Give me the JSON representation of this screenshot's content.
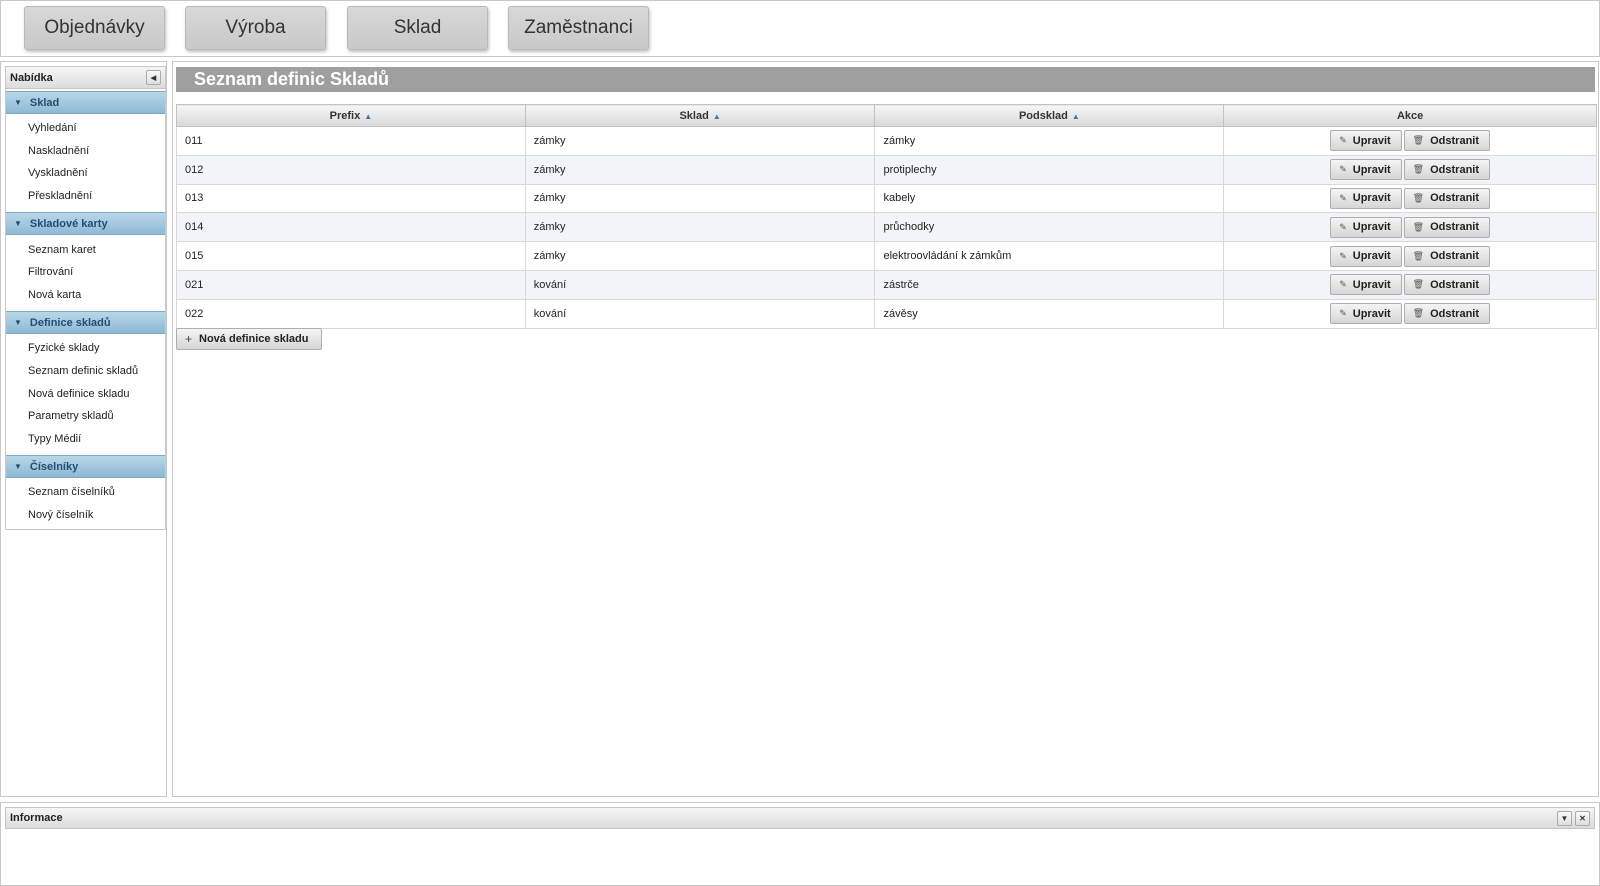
{
  "nav": {
    "tabs": [
      {
        "label": "Objednávky"
      },
      {
        "label": "Výroba"
      },
      {
        "label": "Sklad"
      },
      {
        "label": "Zaměstnanci"
      }
    ]
  },
  "sidebar": {
    "title": "Nabídka",
    "sections": [
      {
        "title": "Sklad",
        "items": [
          "Vyhledání",
          "Naskladnění",
          "Vyskladnění",
          "Přeskladnění"
        ]
      },
      {
        "title": "Skladové karty",
        "items": [
          "Seznam karet",
          "Filtrování",
          "Nová karta"
        ]
      },
      {
        "title": "Definice skladů",
        "items": [
          "Fyzické sklady",
          "Seznam definic skladů",
          "Nová definice skladu",
          "Parametry skladů",
          "Typy Médií"
        ]
      },
      {
        "title": "Číselníky",
        "items": [
          "Seznam číselníků",
          "Nový číselník"
        ]
      }
    ]
  },
  "main": {
    "title": "Seznam definic Skladů",
    "columns": {
      "prefix": "Prefix",
      "sklad": "Sklad",
      "podsklad": "Podsklad",
      "akce": "Akce"
    },
    "rows": [
      {
        "prefix": "011",
        "sklad": "zámky",
        "podsklad": "zámky"
      },
      {
        "prefix": "012",
        "sklad": "zámky",
        "podsklad": "protiplechy"
      },
      {
        "prefix": "013",
        "sklad": "zámky",
        "podsklad": "kabely"
      },
      {
        "prefix": "014",
        "sklad": "zámky",
        "podsklad": "průchodky"
      },
      {
        "prefix": "015",
        "sklad": "zámky",
        "podsklad": "elektroovládání k zámkům"
      },
      {
        "prefix": "021",
        "sklad": "kování",
        "podsklad": "zástrče"
      },
      {
        "prefix": "022",
        "sklad": "kování",
        "podsklad": "závěsy"
      }
    ],
    "edit_label": "Upravit",
    "delete_label": "Odstranit",
    "new_label": "Nová definice skladu"
  },
  "info": {
    "title": "Informace"
  },
  "icons": {
    "edit": "pencil-icon",
    "delete": "trash-icon",
    "add": "plus-icon",
    "sort": "sort-icon",
    "collapse": "chevron-left-icon",
    "expand": "chevron-down-icon",
    "close": "close-icon"
  },
  "colors": {
    "section_head": "#8fb9d4",
    "page_title_bar": "#9f9f9f",
    "row_alt": "#f1f5fa"
  }
}
